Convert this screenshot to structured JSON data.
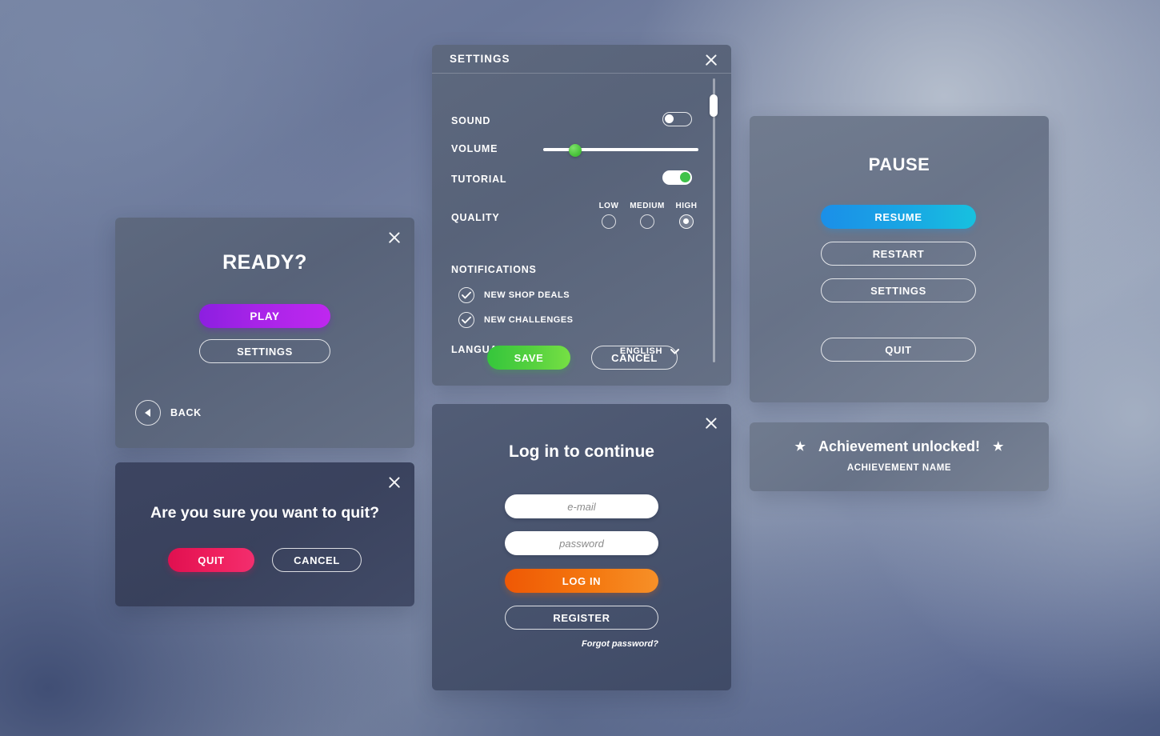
{
  "ready_dialog": {
    "title": "READY?",
    "play_label": "PLAY",
    "settings_label": "SETTINGS",
    "back_label": "BACK",
    "close_icon": "close-icon",
    "back_icon": "chevron-left-icon",
    "accent_color": "#a824e8"
  },
  "quit_dialog": {
    "title": "Are you sure you want to quit?",
    "quit_label": "QUIT",
    "cancel_label": "CANCEL",
    "close_icon": "close-icon",
    "accent_color": "#ef1f5e"
  },
  "settings_dialog": {
    "title": "SETTINGS",
    "close_icon": "close-icon",
    "sound": {
      "label": "SOUND",
      "state": "off"
    },
    "volume": {
      "label": "VOLUME",
      "value": 18
    },
    "tutorial": {
      "label": "TUTORIAL",
      "state": "on",
      "knob_color": "#3fc24a"
    },
    "quality": {
      "label": "QUALITY",
      "options": [
        "LOW",
        "MEDIUM",
        "HIGH"
      ],
      "selected": "HIGH"
    },
    "notifications": {
      "label": "NOTIFICATIONS",
      "items": [
        {
          "label": "NEW SHOP DEALS",
          "checked": true
        },
        {
          "label": "NEW CHALLENGES",
          "checked": true
        }
      ],
      "check_icon": "check-icon"
    },
    "language": {
      "label": "LANGUAGE",
      "value": "ENGLISH",
      "chevron_icon": "chevron-down-icon"
    },
    "save_label": "SAVE",
    "cancel_label": "CANCEL",
    "save_color": "#56d13f",
    "scrollbar": {
      "thumb_position_percent": 6
    }
  },
  "login_dialog": {
    "title": "Log in to continue",
    "close_icon": "close-icon",
    "email": {
      "placeholder": "e-mail",
      "value": ""
    },
    "password": {
      "placeholder": "password",
      "value": ""
    },
    "login_label": "LOG IN",
    "register_label": "REGISTER",
    "forgot_label": "Forgot password?",
    "accent_color": "#f4770f"
  },
  "pause_dialog": {
    "title": "PAUSE",
    "resume_label": "RESUME",
    "restart_label": "RESTART",
    "settings_label": "SETTINGS",
    "quit_label": "QUIT",
    "accent_color": "#19a6e4"
  },
  "achievement_toast": {
    "headline": "Achievement unlocked!",
    "name": "ACHIEVEMENT NAME",
    "star_icon": "★"
  }
}
